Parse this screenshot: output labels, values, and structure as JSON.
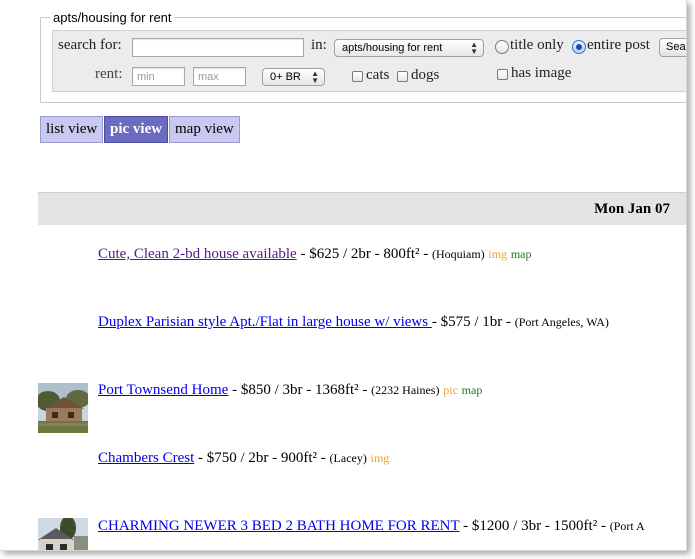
{
  "search": {
    "legend": "apts/housing for rent",
    "search_label": "search for:",
    "search_value": "",
    "in_label": "in:",
    "category_selected": "apts/housing for rent",
    "rent_label": "rent:",
    "min_placeholder": "min",
    "max_placeholder": "max",
    "bedrooms_selected": "0+ BR",
    "cats_label": "cats",
    "dogs_label": "dogs",
    "title_only_label": "title only",
    "entire_post_label": "entire post",
    "has_image_label": "has image",
    "search_button_label": "Sea",
    "search_scope_selected": "entire post"
  },
  "views": {
    "list": "list view",
    "pic": "pic view",
    "map": "map view",
    "active": "pic view"
  },
  "day_header": "Mon Jan 07",
  "listings": [
    {
      "title": "Cute, Clean 2-bd house available",
      "details": " - $625 / 2br - 800ft² - ",
      "location": "(Hoquiam)",
      "tags": [
        "img",
        "map"
      ],
      "visited": true,
      "thumb": false
    },
    {
      "title": "Duplex Parisian style Apt./Flat in large house w/ views ",
      "details": " - $575 / 1br - ",
      "location": "(Port Angeles, WA)",
      "tags": [],
      "visited": false,
      "thumb": false
    },
    {
      "title": "Port Townsend Home",
      "details": " - $850 / 3br - 1368ft² - ",
      "location": "(2232 Haines)",
      "tags": [
        "pic",
        "map"
      ],
      "visited": false,
      "thumb": true
    },
    {
      "title": "Chambers Crest",
      "details": " - $750 / 2br - 900ft² - ",
      "location": "(Lacey)",
      "tags": [
        "img"
      ],
      "visited": false,
      "thumb": false
    },
    {
      "title": "CHARMING NEWER 3 BED 2 BATH HOME FOR RENT",
      "details": " - $1200 / 3br - 1500ft² - ",
      "location": "(Port A",
      "tags": [],
      "visited": false,
      "thumb": true
    }
  ],
  "colors": {
    "link": "#0000ee",
    "visited_link": "#551a8b",
    "img_tag": "#f0a030",
    "map_tag": "#1a7a1a",
    "active_view": "#6b6bc0",
    "inactive_view": "#c8c8f0"
  }
}
